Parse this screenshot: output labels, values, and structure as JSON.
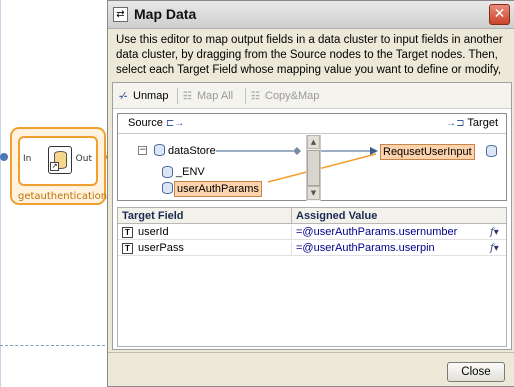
{
  "canvas": {
    "node": {
      "label": "getauthentication",
      "in_label": "In",
      "out_label": "Out"
    }
  },
  "dialog": {
    "title": "Map Data",
    "close_icon": "close-x",
    "description": "Use this editor to map output fields in a data cluster to input fields in another data cluster, by dragging from the Source nodes to the Target nodes. Then, select each Target Field whose mapping value you want to define or modify, and enter its Assigned Value.",
    "toolbar": {
      "unmap_label": "Unmap",
      "map_all_label": "Map All",
      "copy_map_label": "Copy&Map"
    },
    "mapping": {
      "source_label": "Source",
      "target_label": "Target",
      "source_root": "dataStore",
      "source_children": [
        "_ENV",
        "userAuthParams"
      ],
      "target_node": "RequsetUserInput"
    },
    "grid": {
      "headers": [
        "Target Field",
        "Assigned Value"
      ],
      "rows": [
        {
          "field": "userId",
          "value": "=@userAuthParams.usernumber"
        },
        {
          "field": "userPass",
          "value": "=@userAuthParams.userpin"
        }
      ]
    },
    "close_button_label": "Close"
  },
  "colors": {
    "node_accent": "#f0a030",
    "highlight": "#fdd3ad",
    "dialog_bg": "#ece9d8",
    "close_red": "#c9442b"
  }
}
